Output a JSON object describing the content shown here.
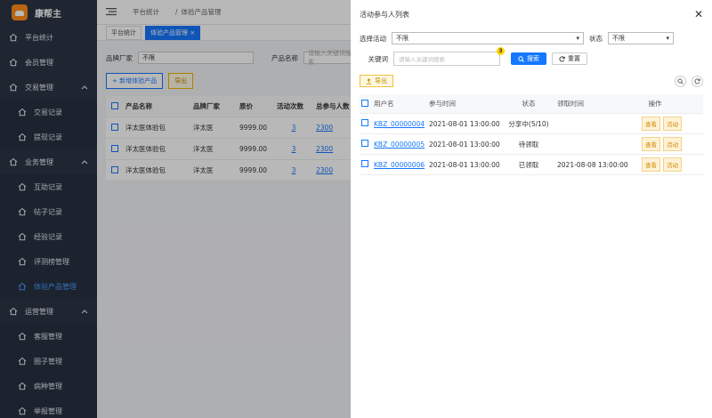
{
  "brand": {
    "name": "康帮主"
  },
  "sidebar": {
    "items": [
      {
        "label": "平台统计",
        "type": "group",
        "icon": "home-icon",
        "chevron": false
      },
      {
        "label": "会员管理",
        "type": "group",
        "icon": "home-icon",
        "chevron": false
      },
      {
        "label": "交易管理",
        "type": "group",
        "icon": "home-icon",
        "chevron": true
      },
      {
        "label": "交易记录",
        "type": "sub",
        "icon": "home-icon"
      },
      {
        "label": "提现记录",
        "type": "sub",
        "icon": "home-icon"
      },
      {
        "label": "业务管理",
        "type": "group",
        "icon": "home-icon",
        "chevron": true
      },
      {
        "label": "互助记录",
        "type": "sub",
        "icon": "home-icon"
      },
      {
        "label": "帖子记录",
        "type": "sub",
        "icon": "home-icon"
      },
      {
        "label": "经验记录",
        "type": "sub",
        "icon": "home-icon"
      },
      {
        "label": "评测榜管理",
        "type": "sub",
        "icon": "home-icon"
      },
      {
        "label": "体验产品管理",
        "type": "sub",
        "icon": "home-icon",
        "active": true
      },
      {
        "label": "运营管理",
        "type": "group",
        "icon": "home-icon",
        "chevron": true
      },
      {
        "label": "客服管理",
        "type": "sub",
        "icon": "home-icon"
      },
      {
        "label": "圈子管理",
        "type": "sub",
        "icon": "home-icon"
      },
      {
        "label": "病种管理",
        "type": "sub",
        "icon": "home-icon"
      },
      {
        "label": "举报管理",
        "type": "sub",
        "icon": "home-icon"
      }
    ]
  },
  "main": {
    "breadcrumb": [
      "平台统计",
      "/",
      "体验产品管理"
    ],
    "tabs": [
      "平台统计",
      "体验产品管理 ×"
    ],
    "filters": {
      "brand_label": "品牌厂家",
      "brand_value": "不限",
      "product_label": "产品名称",
      "product_placeholder": "请输入关键词搜索"
    },
    "add_button": "+ 新增体验产品",
    "export_button": "导出",
    "table": {
      "headers": [
        "产品名称",
        "品牌厂家",
        "原价",
        "活动次数",
        "总参与人数"
      ],
      "rows": [
        [
          "洋太医体验包",
          "洋太医",
          "9999.00",
          "3",
          "2300"
        ],
        [
          "洋太医体验包",
          "洋太医",
          "9999.00",
          "3",
          "2300"
        ],
        [
          "洋太医体验包",
          "洋太医",
          "9999.00",
          "3",
          "2300"
        ]
      ]
    }
  },
  "drawer": {
    "title": "活动参与人列表",
    "activity_label": "选择活动",
    "activity_value": "不限",
    "status_label": "状态",
    "status_value": "不限",
    "keyword_label": "关键词",
    "keyword_placeholder": "请输入关键词搜索",
    "badge": "3",
    "search_button": "搜索",
    "reset_button": "重置",
    "export_button": "导出",
    "table": {
      "headers": [
        "用户名",
        "参与时间",
        "状态",
        "领取时间",
        "操作"
      ],
      "rows": [
        {
          "user": "KBZ_00000004",
          "time": "2021-08-01 13:00:00",
          "state": "分享中(5/10)",
          "claim": "",
          "op1": "查看",
          "op2": "活动"
        },
        {
          "user": "KBZ_00000005",
          "time": "2021-08-01 13:00:00",
          "state": "待领取",
          "claim": "",
          "op1": "查看",
          "op2": "活动"
        },
        {
          "user": "KBZ_00000006",
          "time": "2021-08-01 13:00:00",
          "state": "已领取",
          "claim": "2021-08-08 13:00:00",
          "op1": "查看",
          "op2": "活动"
        }
      ]
    }
  }
}
